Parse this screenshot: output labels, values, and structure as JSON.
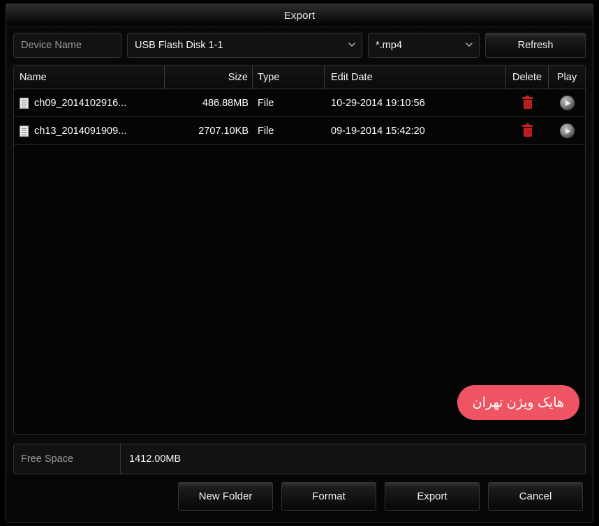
{
  "window": {
    "title": "Export"
  },
  "toolbar": {
    "device_label": "Device Name",
    "device_value": "USB Flash Disk 1-1",
    "format_value": "*.mp4",
    "refresh_label": "Refresh",
    "caret_icon": "chevron-down-icon"
  },
  "file_list": {
    "columns": {
      "name": "Name",
      "size": "Size",
      "type": "Type",
      "edit_date": "Edit Date",
      "delete": "Delete",
      "play": "Play"
    },
    "rows": [
      {
        "name": "ch09_2014102916...",
        "size": "486.88MB",
        "type": "File",
        "edit_date": "10-29-2014 19:10:56",
        "delete_icon": "trash-icon",
        "play_icon": "play-icon",
        "file_icon": "file-document-icon"
      },
      {
        "name": "ch13_2014091909...",
        "size": "2707.10KB",
        "type": "File",
        "edit_date": "09-19-2014 15:42:20",
        "delete_icon": "trash-icon",
        "play_icon": "play-icon",
        "file_icon": "file-document-icon"
      }
    ]
  },
  "watermark": {
    "text": "هایک ویژن تهران",
    "color": "#ef5463"
  },
  "free_space": {
    "label": "Free Space",
    "value": "1412.00MB"
  },
  "footer": {
    "new_folder": "New Folder",
    "format": "Format",
    "export": "Export",
    "cancel": "Cancel"
  }
}
